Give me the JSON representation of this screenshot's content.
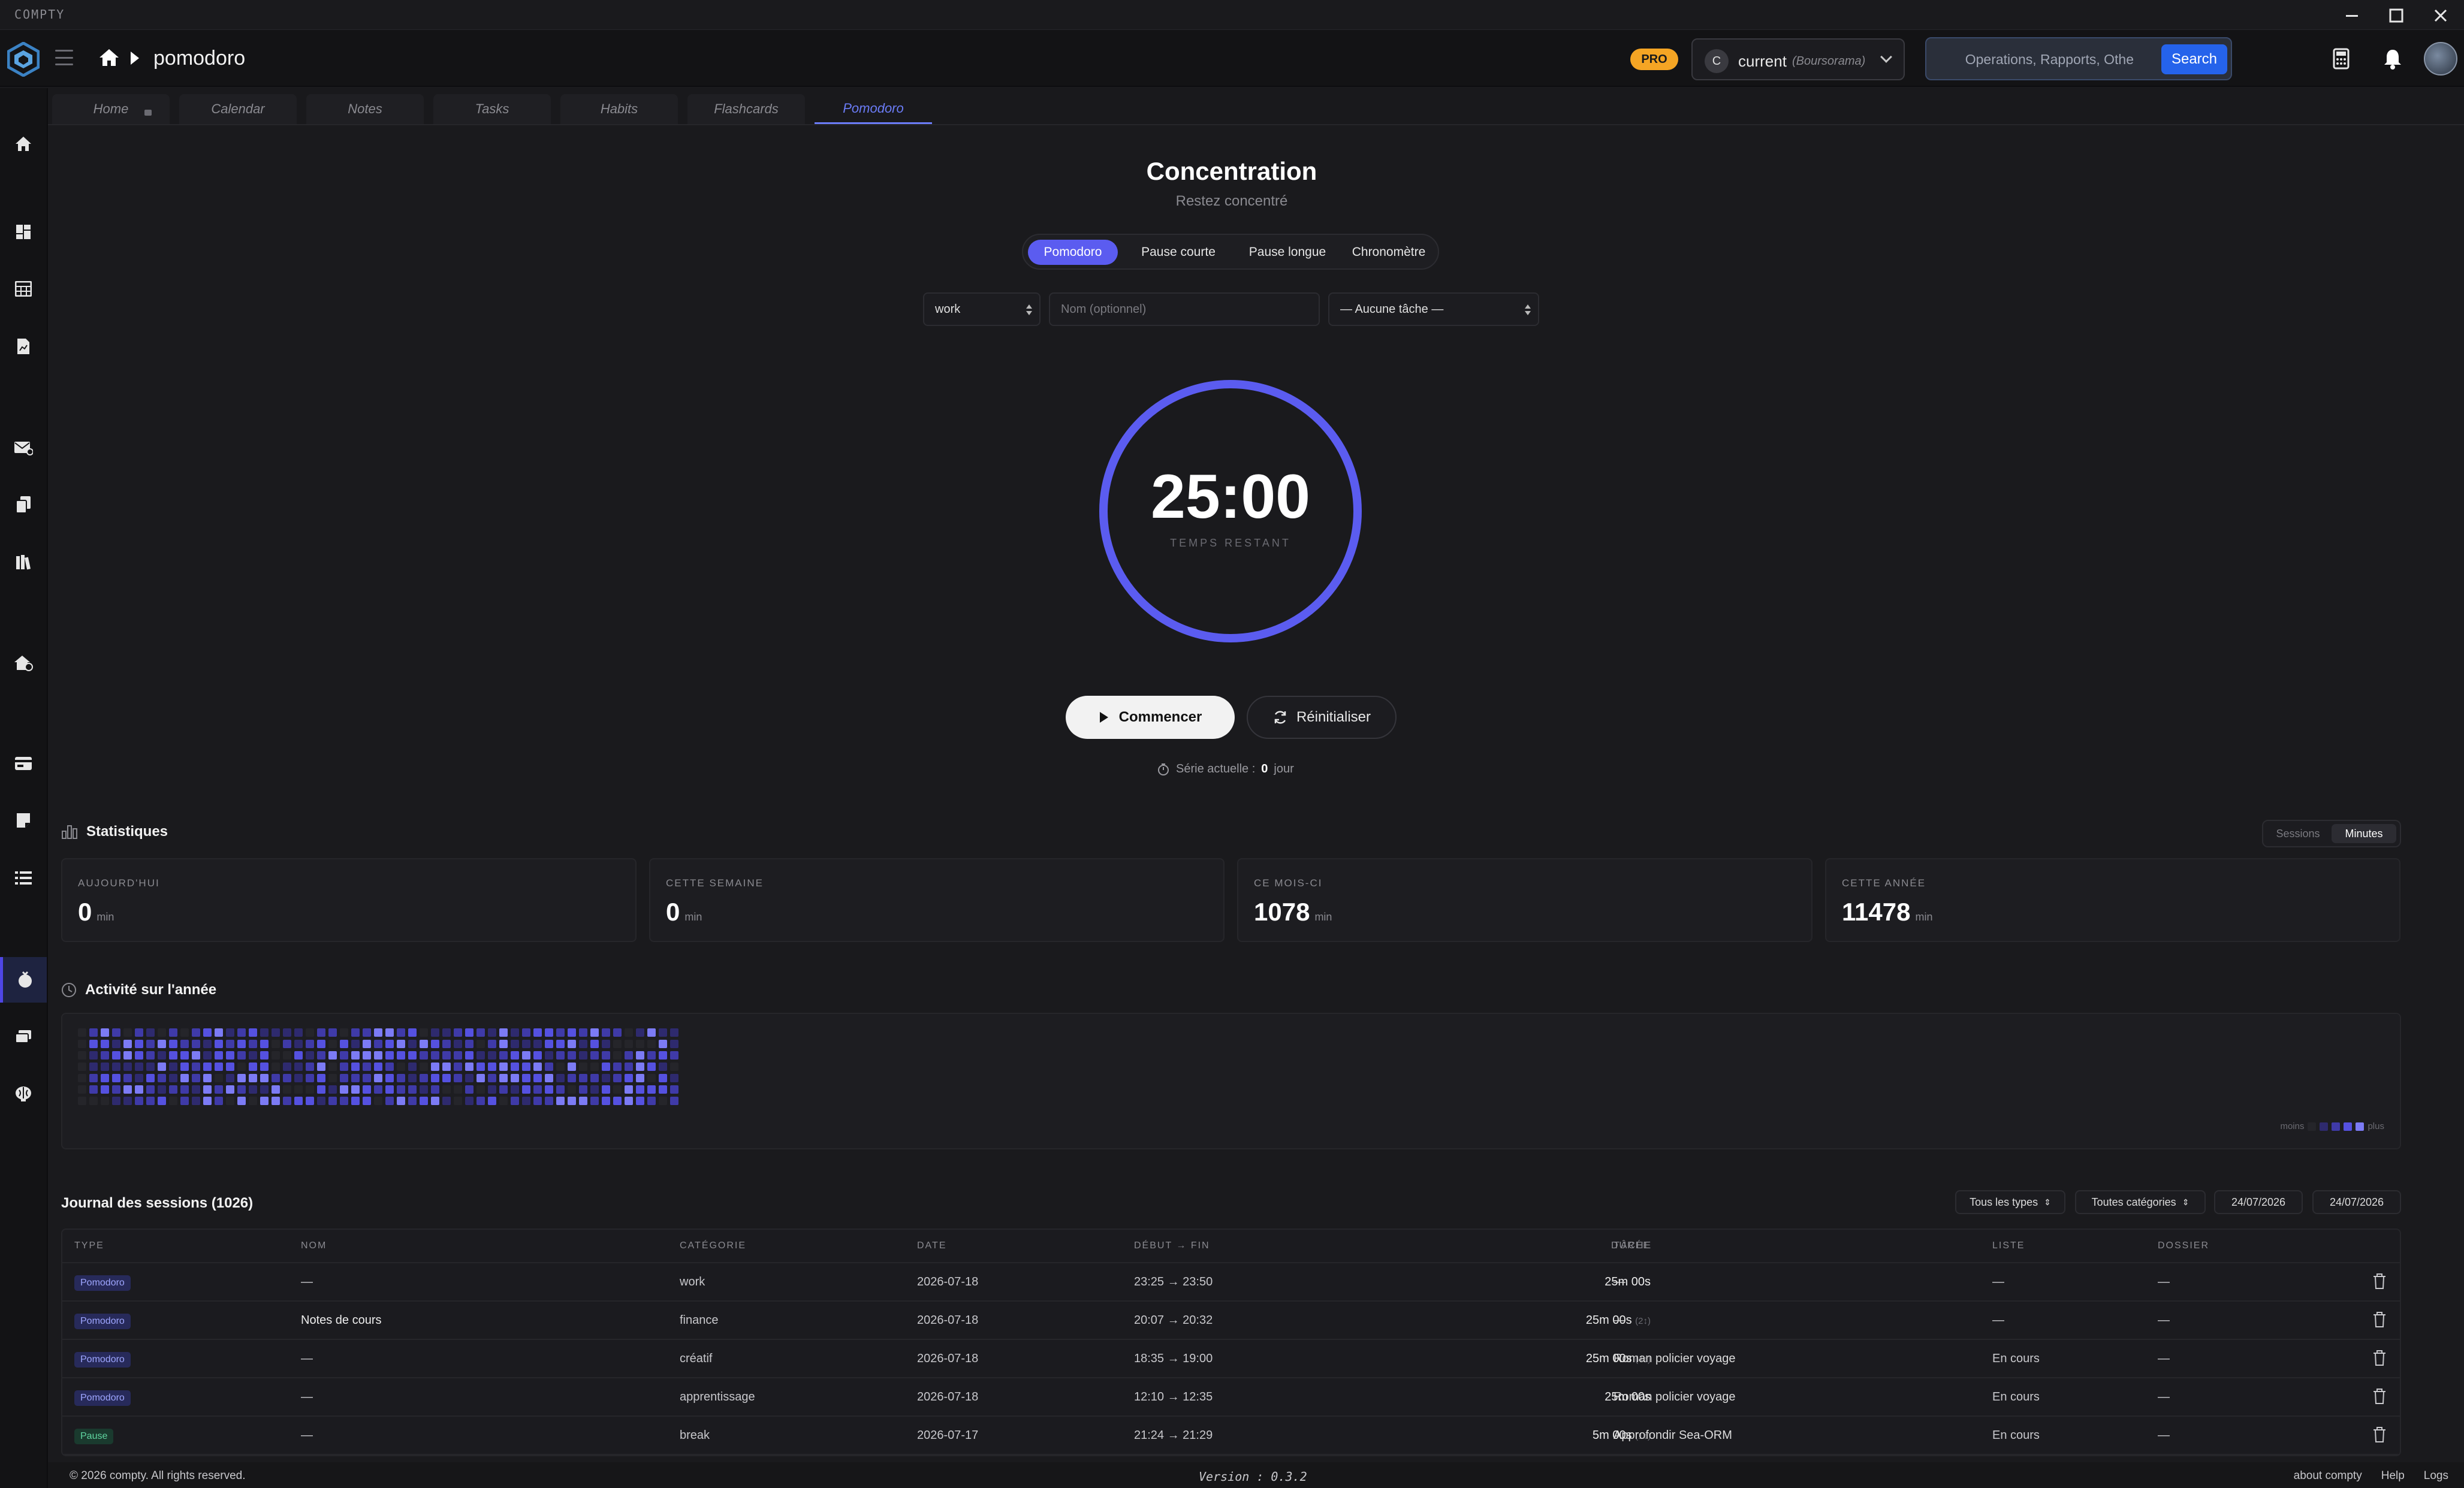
{
  "window": {
    "app_name": "COMPTY"
  },
  "header": {
    "breadcrumb": "pomodoro",
    "pro_badge": "PRO",
    "account": {
      "initial": "C",
      "name": "current",
      "bank": "(Boursorama)"
    },
    "search": {
      "placeholder": "Operations, Rapports, Othe",
      "button": "Search"
    }
  },
  "tabs": [
    "Home",
    "Calendar",
    "Notes",
    "Tasks",
    "Habits",
    "Flashcards",
    "Pomodoro"
  ],
  "focus": {
    "title": "Concentration",
    "subtitle": "Restez concentré",
    "modes": [
      "Pomodoro",
      "Pause courte",
      "Pause longue",
      "Chronomètre"
    ],
    "category_select": "work",
    "name_placeholder": "Nom (optionnel)",
    "task_select": "— Aucune tâche —",
    "timer": "25:00",
    "timer_label": "TEMPS RESTANT",
    "timer_progress": 1.0,
    "start_button": "Commencer",
    "reset_button": "Réinitialiser",
    "streak_label": "Série actuelle :",
    "streak_value": "0",
    "streak_unit": "jour"
  },
  "stats": {
    "title": "Statistiques",
    "toggle": [
      "Sessions",
      "Minutes"
    ],
    "cards": [
      {
        "label": "AUJOURD'HUI",
        "value": "0",
        "unit": "min"
      },
      {
        "label": "CETTE SEMAINE",
        "value": "0",
        "unit": "min"
      },
      {
        "label": "CE MOIS-CI",
        "value": "1078",
        "unit": "min"
      },
      {
        "label": "CETTE ANNÉE",
        "value": "11478",
        "unit": "min"
      }
    ]
  },
  "activity": {
    "title": "Activité sur l'année",
    "legend_less": "moins",
    "legend_more": "plus",
    "levels": [
      "#25252a",
      "#2e2a6e",
      "#3f3aa8",
      "#5551e0",
      "#7c7bf5"
    ]
  },
  "journal": {
    "title": "Journal des sessions (1026)",
    "filters": {
      "type": "Tous les types",
      "category": "Toutes catégories",
      "from": "24/07/2026",
      "to": "24/07/2026"
    },
    "columns": [
      "TYPE",
      "NOM",
      "CATÉGORIE",
      "DATE",
      "DÉBUT → FIN",
      "DURÉE",
      "TÂCHE",
      "LISTE",
      "DOSSIER"
    ],
    "rows": [
      {
        "type": "Pomodoro",
        "kind": "pomo",
        "nom": "—",
        "categorie": "work",
        "date": "2026-07-18",
        "debut_fin": "23:25 → 23:50",
        "duree": "25m 00s",
        "extra": "",
        "tache": "—",
        "liste": "—",
        "dossier": "—"
      },
      {
        "type": "Pomodoro",
        "kind": "pomo",
        "nom": "Notes de cours",
        "categorie": "finance",
        "date": "2026-07-18",
        "debut_fin": "20:07 → 20:32",
        "duree": "25m 00s",
        "extra": "(2↕)",
        "tache": "—",
        "liste": "—",
        "dossier": "—"
      },
      {
        "type": "Pomodoro",
        "kind": "pomo",
        "nom": "—",
        "categorie": "créatif",
        "date": "2026-07-18",
        "debut_fin": "18:35 → 19:00",
        "duree": "25m 00s",
        "extra": "(4↕)",
        "tache": "Roman policier voyage",
        "liste": "En cours",
        "dossier": "—"
      },
      {
        "type": "Pomodoro",
        "kind": "pomo",
        "nom": "—",
        "categorie": "apprentissage",
        "date": "2026-07-18",
        "debut_fin": "12:10 → 12:35",
        "duree": "25m 00s",
        "extra": "",
        "tache": "Roman policier voyage",
        "liste": "En cours",
        "dossier": "—"
      },
      {
        "type": "Pause",
        "kind": "pause",
        "nom": "—",
        "categorie": "break",
        "date": "2026-07-17",
        "debut_fin": "21:24 → 21:29",
        "duree": "5m 00s",
        "extra": "(1↕)",
        "tache": "Approfondir Sea-ORM",
        "liste": "En cours",
        "dossier": "—"
      }
    ]
  },
  "footer": {
    "copyright": "© 2026 compty. All rights reserved.",
    "version": "Version : 0.3.2",
    "links": [
      "about compty",
      "Help",
      "Logs"
    ]
  }
}
